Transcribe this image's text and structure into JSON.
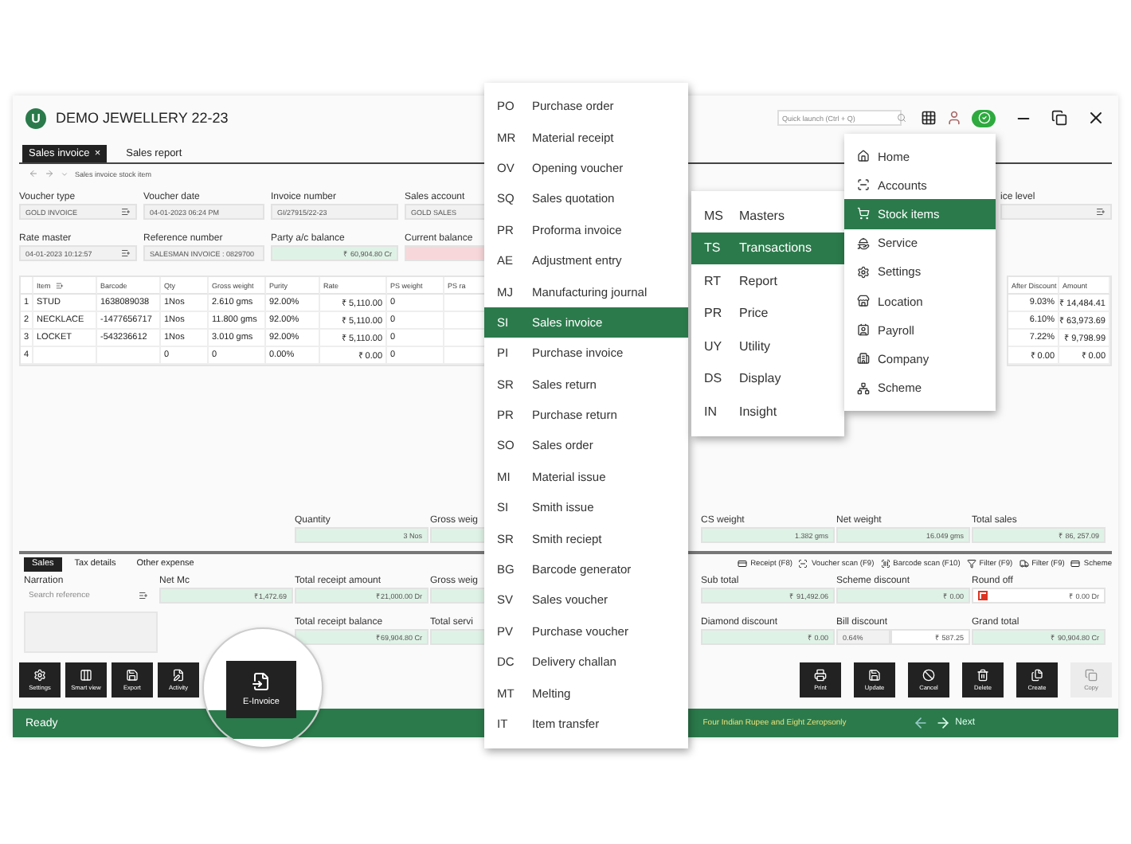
{
  "app": {
    "logo": "U",
    "title": "DEMO JEWELLERY 22-23",
    "search": {
      "placeholder": "Quick launch (Ctrl + Q)"
    }
  },
  "tabs": [
    {
      "label": "Sales invoice",
      "close": "×",
      "selected": true
    },
    {
      "label": "Sales report",
      "selected": false
    }
  ],
  "breadcrumb": "Sales invoice stock item",
  "form_rows": [
    [
      {
        "label": "Voucher type",
        "value": "GOLD INVOICE",
        "kind": "select"
      },
      {
        "label": "Voucher date",
        "value": "04-01-2023 06:24 PM",
        "kind": "text"
      },
      {
        "label": "Invoice number",
        "value": "GI/27915/22-23",
        "kind": "text"
      },
      {
        "label": "Sales account",
        "value": "GOLD SALES",
        "kind": "text"
      }
    ],
    [
      {
        "label": "Rate master",
        "value": "04-01-2023 10:12:57",
        "kind": "select"
      },
      {
        "label": "Reference number",
        "value": "SALESMAN INVOICE : 0829700",
        "kind": "text"
      },
      {
        "label": "Party a/c balance",
        "value": "₹ 60,904.80 Cr",
        "kind": "credit"
      },
      {
        "label": "Current balance",
        "kind": "alert"
      }
    ]
  ],
  "right_field": {
    "label": "ice level",
    "kind": "select"
  },
  "table": {
    "columns": [
      "Item",
      "Barcode",
      "Qty",
      "Gross weight",
      "Purity",
      "Rate",
      "PS weight",
      "PS ra"
    ],
    "rows": [
      {
        "number": "1",
        "cells": [
          "STUD",
          "1638089038",
          "1Nos",
          "2.610 gms",
          "92.00%",
          "₹ 5,110.00",
          "0"
        ]
      },
      {
        "number": "2",
        "cells": [
          "NECKLACE",
          "-1477656717",
          "1Nos",
          "11.800 gms",
          "92.00%",
          "₹ 5,110.00",
          "0"
        ]
      },
      {
        "number": "3",
        "cells": [
          "LOCKET",
          "-543236612",
          "1Nos",
          "3.010 gms",
          "92.00%",
          "₹ 5,110.00",
          "0"
        ]
      },
      {
        "number": "4",
        "cells": [
          "",
          "",
          "0",
          "0",
          "0.00%",
          "₹ 0.00",
          "0"
        ]
      }
    ]
  },
  "right_table": {
    "columns": [
      "After Discount",
      "Amount"
    ],
    "rows": [
      [
        "9.03%",
        "₹ 14,484.41"
      ],
      [
        "6.10%",
        "₹ 63,973.69"
      ],
      [
        "7.22%",
        "₹ 9,798.99"
      ],
      [
        "₹ 0.00",
        "₹ 0.00"
      ]
    ]
  },
  "totals": {
    "left": [
      {
        "label": "Quantity",
        "value": "3 Nos"
      },
      {
        "label": "Gross weig"
      }
    ],
    "right": [
      {
        "label": "CS weight",
        "value": "1.382 gms"
      },
      {
        "label": "Net weight",
        "value": "16.049 gms"
      },
      {
        "label": "Total sales",
        "value": "₹ 86, 257.09"
      }
    ]
  },
  "bottom_tabs": [
    {
      "label": "Sales",
      "selected": true
    },
    {
      "label": "Tax details",
      "selected": false
    },
    {
      "label": "Other expense",
      "selected": false
    }
  ],
  "shortcuts": [
    {
      "label": "Receipt (F8)",
      "kind": "card"
    },
    {
      "label": "Voucher scan (F9)",
      "kind": "scan"
    },
    {
      "label": "Barcode scan (F10)",
      "kind": "barcode"
    },
    {
      "label": "Filter (F9)",
      "kind": "filter"
    },
    {
      "label": "Filter (F9)",
      "kind": "truck"
    },
    {
      "label": "Scheme",
      "kind": "card"
    }
  ],
  "narration": {
    "label": "Narration",
    "placeholder": "Search reference"
  },
  "summary_rows": [
    {
      "left": [
        {
          "label": "Net Mc",
          "value": "₹1,472.69",
          "kind": "credit"
        },
        {
          "label": "Total receipt amount",
          "value": "₹21,000.00 Dr",
          "kind": "credit"
        },
        {
          "label": "Gross weig",
          "kind": "credit"
        }
      ],
      "right": [
        {
          "label": "Sub total",
          "value": "₹ 91,492.06",
          "kind": "credit"
        },
        {
          "label": "Scheme discount",
          "value": "₹ 0.00",
          "kind": "credit"
        },
        {
          "label": "Round off",
          "value": "₹ 0.00  Dr",
          "kind": "check",
          "checked": true
        }
      ]
    },
    {
      "left": [
        {
          "label": "Total receipt balance",
          "value": "₹69,904.80 Cr",
          "kind": "credit"
        },
        {
          "label": "Total servi",
          "kind": "credit"
        }
      ],
      "right": [
        {
          "label": "Diamond discount",
          "value": "₹ 0.00",
          "kind": "credit"
        },
        {
          "label": "Bill discount",
          "values": [
            "0.64%",
            "₹ 587.25"
          ],
          "kind": "pair"
        },
        {
          "label": "Grand total",
          "value": "₹ 90,904.80 Cr",
          "kind": "credit"
        }
      ]
    }
  ],
  "left_buttons": [
    {
      "label": "Settings",
      "kind": "settings"
    },
    {
      "label": "Smart view",
      "kind": "view"
    },
    {
      "label": "Export",
      "kind": "save"
    },
    {
      "label": "Activity",
      "kind": "edit"
    }
  ],
  "magnified_button": {
    "label": "E-Invoice",
    "kind": "file"
  },
  "right_buttons": [
    {
      "label": "Print",
      "kind": "print",
      "disabled": false
    },
    {
      "label": "Update",
      "kind": "save",
      "disabled": false
    },
    {
      "label": "Cancel",
      "kind": "cancel",
      "disabled": false
    },
    {
      "label": "Delete",
      "kind": "delete",
      "disabled": false
    },
    {
      "label": "Create",
      "kind": "files",
      "disabled": false
    },
    {
      "label": "Copy",
      "kind": "copy",
      "disabled": true
    }
  ],
  "status": {
    "text": "Ready",
    "amount_words": "Four Indian Rupee and Eight Zeropsonly",
    "next": "Next"
  },
  "voucher_menu": [
    {
      "code": "PO",
      "label": "Purchase order",
      "selected": false
    },
    {
      "code": "MR",
      "label": "Material receipt",
      "selected": false
    },
    {
      "code": "OV",
      "label": "Opening voucher",
      "selected": false
    },
    {
      "code": "SQ",
      "label": "Sales quotation",
      "selected": false
    },
    {
      "code": "PR",
      "label": "Proforma invoice",
      "selected": false
    },
    {
      "code": "AE",
      "label": "Adjustment entry",
      "selected": false
    },
    {
      "code": "MJ",
      "label": "Manufacturing journal",
      "selected": false
    },
    {
      "code": "SI",
      "label": "Sales invoice",
      "selected": true
    },
    {
      "code": "PI",
      "label": "Purchase invoice",
      "selected": false
    },
    {
      "code": "SR",
      "label": "Sales return",
      "selected": false
    },
    {
      "code": "PR",
      "label": "Purchase return",
      "selected": false
    },
    {
      "code": "SO",
      "label": "Sales order",
      "selected": false
    },
    {
      "code": "MI",
      "label": "Material issue",
      "selected": false
    },
    {
      "code": "SI",
      "label": "Smith issue",
      "selected": false
    },
    {
      "code": "SR",
      "label": "Smith reciept",
      "selected": false
    },
    {
      "code": "BG",
      "label": "Barcode generator",
      "selected": false
    },
    {
      "code": "SV",
      "label": "Sales voucher",
      "selected": false
    },
    {
      "code": "PV",
      "label": "Purchase voucher",
      "selected": false
    },
    {
      "code": "DC",
      "label": "Delivery challan",
      "selected": false
    },
    {
      "code": "MT",
      "label": "Melting",
      "selected": false
    },
    {
      "code": "IT",
      "label": "Item transfer",
      "selected": false
    }
  ],
  "sub_menu": [
    {
      "code": "MS",
      "label": "Masters",
      "selected": false
    },
    {
      "code": "TS",
      "label": "Transactions",
      "selected": true
    },
    {
      "code": "RT",
      "label": "Report",
      "selected": false
    },
    {
      "code": "PR",
      "label": "Price",
      "selected": false
    },
    {
      "code": "UY",
      "label": "Utility",
      "selected": false
    },
    {
      "code": "DS",
      "label": "Display",
      "selected": false
    },
    {
      "code": "IN",
      "label": "Insight",
      "selected": false
    }
  ],
  "main_menu": [
    {
      "label": "Home",
      "kind": "home",
      "selected": false
    },
    {
      "label": "Accounts",
      "kind": "scan",
      "selected": false
    },
    {
      "label": "Stock items",
      "kind": "cart",
      "selected": true
    },
    {
      "label": "Service",
      "kind": "hand",
      "selected": false
    },
    {
      "label": "Settings",
      "kind": "settings",
      "selected": false
    },
    {
      "label": "Location",
      "kind": "store",
      "selected": false
    },
    {
      "label": "Payroll",
      "kind": "contact",
      "selected": false
    },
    {
      "label": "Company",
      "kind": "building",
      "selected": false
    },
    {
      "label": "Scheme",
      "kind": "network",
      "selected": false
    }
  ]
}
